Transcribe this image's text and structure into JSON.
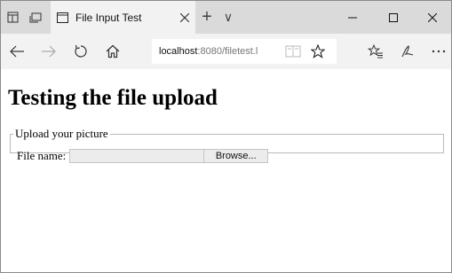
{
  "titlebar": {
    "tab_title": "File Input Test",
    "new_tab_symbol": "+",
    "tab_list_symbol": "∨",
    "icons": [
      "set-tabs-aside-icon",
      "tab-preview-icon",
      "page-icon",
      "close-icon",
      "minimize-icon",
      "maximize-icon",
      "close-window-icon"
    ]
  },
  "navbar": {
    "url_host": "localhost",
    "url_rest": ":8080/filetest.l",
    "icons": [
      "back-icon",
      "forward-icon",
      "refresh-icon",
      "home-icon",
      "reading-view-icon",
      "favorite-star-icon",
      "favorites-hub-icon",
      "web-note-icon",
      "more-icon"
    ]
  },
  "page": {
    "heading": "Testing the file upload",
    "legend": "Upload your picture",
    "file_label": "File name:",
    "file_value": "",
    "browse_label": "Browse..."
  },
  "colors": {
    "titlebar_bg": "#dadada",
    "tab_bg": "#f2f2f2",
    "navbar_bg": "#f2f2f2",
    "page_bg": "#ffffff"
  }
}
